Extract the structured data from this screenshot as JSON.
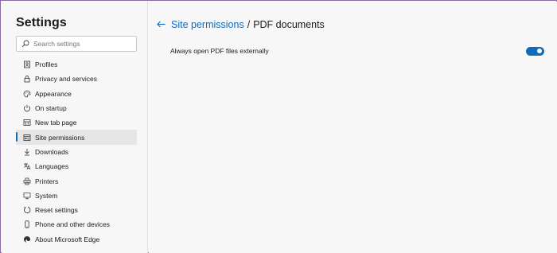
{
  "sidebar": {
    "title": "Settings",
    "search_placeholder": "Search settings",
    "items": [
      {
        "label": "Profiles",
        "icon": "profile-icon"
      },
      {
        "label": "Privacy and services",
        "icon": "lock-icon"
      },
      {
        "label": "Appearance",
        "icon": "palette-icon"
      },
      {
        "label": "On startup",
        "icon": "power-icon"
      },
      {
        "label": "New tab page",
        "icon": "grid-icon"
      },
      {
        "label": "Site permissions",
        "icon": "site-permissions-icon",
        "active": true
      },
      {
        "label": "Downloads",
        "icon": "download-icon"
      },
      {
        "label": "Languages",
        "icon": "languages-icon"
      },
      {
        "label": "Printers",
        "icon": "printer-icon"
      },
      {
        "label": "System",
        "icon": "system-icon"
      },
      {
        "label": "Reset settings",
        "icon": "reset-icon"
      },
      {
        "label": "Phone and other devices",
        "icon": "phone-icon"
      },
      {
        "label": "About Microsoft Edge",
        "icon": "edge-icon"
      }
    ]
  },
  "main": {
    "breadcrumb": {
      "parent": "Site permissions",
      "separator": "/",
      "current": "PDF documents"
    },
    "settings": [
      {
        "label": "Always open PDF files externally",
        "enabled": true
      }
    ]
  },
  "colors": {
    "accent": "#0f6cbd",
    "background": "#f7f7f7",
    "active_item": "#e6e6e6"
  }
}
